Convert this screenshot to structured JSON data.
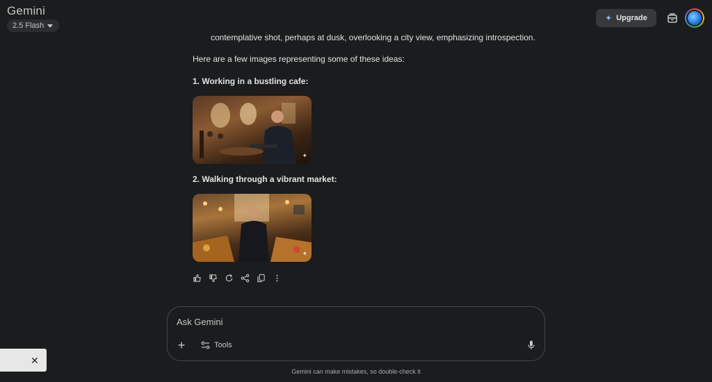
{
  "header": {
    "title": "Gemini",
    "model_label": "2.5 Flash",
    "upgrade_label": "Upgrade"
  },
  "response": {
    "truncated_line": "contemplative shot, perhaps at dusk, overlooking a city view, emphasizing introspection.",
    "intro": "Here are a few images representing some of these ideas:",
    "items": [
      {
        "heading": "1. Working in a bustling cafe:"
      },
      {
        "heading": "2. Walking through a vibrant market:"
      }
    ]
  },
  "composer": {
    "placeholder": "Ask Gemini",
    "tools_label": "Tools"
  },
  "footer": {
    "disclaimer": "Gemini can make mistakes, so double-check it"
  },
  "icons": {
    "upgrade": "sparkle-icon",
    "temp_chat": "temporary-chat-icon",
    "actions": [
      "thumbs-up-icon",
      "thumbs-down-icon",
      "redo-icon",
      "share-icon",
      "copy-icon",
      "more-vert-icon"
    ],
    "composer": [
      "plus-icon",
      "tools-icon",
      "mic-icon"
    ],
    "toast": "close-icon"
  },
  "colors": {
    "background": "#1b1c1d",
    "text": "#e3e3e3",
    "muted": "#c4c7c5",
    "chip": "#2c2d2f",
    "upgrade_bg": "#36383a",
    "composer_border": "#444746"
  }
}
